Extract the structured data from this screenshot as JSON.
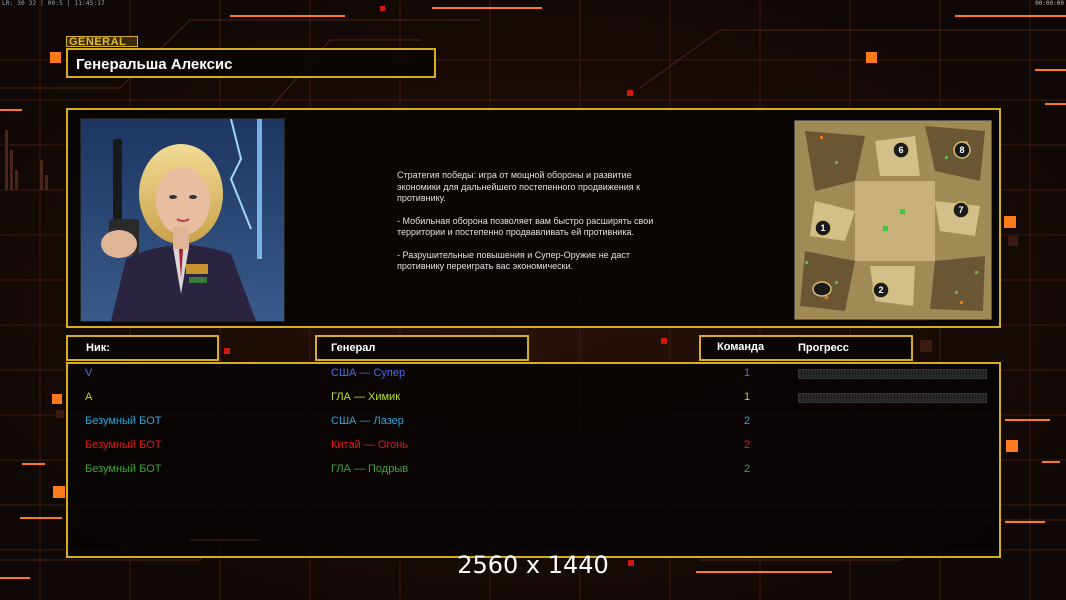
{
  "hud": {
    "top_left": "LR: 30 32 | 00:5 | 11:45:17",
    "top_right": "00:00:00"
  },
  "general": {
    "tab_label": "GENERAL",
    "name": "Генеральша Алексис",
    "description": [
      "Стратегия победы: игра от мощной обороны и развитие\n экономики для дальнейшего постепенного продвижения к\n противнику.",
      "- Мобильная оборона позволяет вам быстро расширять свои\n территории и постепенно продвавливать ей противника.",
      "- Разрушительные повышения и Супер-Оружие не даст\n противнику переиграть вас экономически."
    ]
  },
  "table": {
    "headers": {
      "nick": "Ник:",
      "general": "Генерал",
      "team": "Команда",
      "progress": "Прогресс"
    },
    "rows": [
      {
        "nick": "V",
        "general": "США — Супер",
        "team": "1",
        "color": "#4a6cf0",
        "progress": 0,
        "show_progress": true
      },
      {
        "nick": "A",
        "general": "ГЛА — Химик",
        "team": "1",
        "color": "#b8e028",
        "progress": 0,
        "show_progress": true
      },
      {
        "nick": "Безумный БОТ",
        "general": "США — Лазер",
        "team": "2",
        "color": "#2aa7e0",
        "show_progress": false
      },
      {
        "nick": "Безумный БОТ",
        "general": "Китай — Огонь",
        "team": "2",
        "color": "#e01a1a",
        "show_progress": false
      },
      {
        "nick": "Безумный БОТ",
        "general": "ГЛА — Подрыв",
        "team": "2",
        "color": "#3ca832",
        "show_progress": false
      }
    ]
  },
  "minimap": {
    "start_positions": [
      "6",
      "8",
      "7",
      "1",
      "2"
    ]
  },
  "overlay": {
    "resolution": "2560 x 1440"
  },
  "colors": {
    "frame": "#d6ae22",
    "accent_orange": "#ff7a1a",
    "background": "#120a07"
  }
}
